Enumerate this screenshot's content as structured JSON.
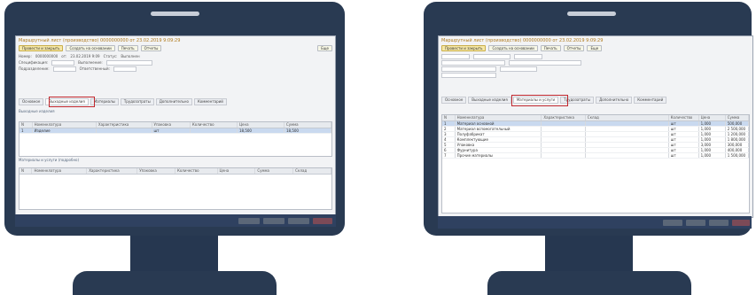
{
  "left_monitor": {
    "window_title": "Маршрутный лист (производство) 0000000000 от 23.02.2019 9:09:29",
    "toolbar": {
      "post_and_close": "Провести и закрыть",
      "create_based": "Создать на основании",
      "print": "Печать",
      "reports": "Отчеты",
      "more": "Еще"
    },
    "header_fields": {
      "number_label": "Номер:",
      "number_value": "0000000000",
      "date_label": "от:",
      "date_value": "23.02.2019 9:09",
      "status_label": "Статус:",
      "status_value": "Выполнен",
      "spec_label": "Спецификация:",
      "period_label": "Выполнение:",
      "dept_label": "Подразделение:",
      "resp_label": "Ответственный:"
    },
    "tabs": [
      "Основное",
      "Выходные изделия",
      "Материалы",
      "Трудозатраты",
      "Дополнительно",
      "Комментарий"
    ],
    "active_tab_index": 1,
    "top_section_label": "Выходные изделия",
    "top_grid": {
      "columns": [
        "N",
        "Номенклатура",
        "Характеристика",
        "Упаковка",
        "Количество",
        "Цена",
        "Сумма"
      ],
      "rows": [
        [
          "1",
          "Изделие",
          "",
          "шт",
          "",
          "18,500",
          "18,500"
        ]
      ]
    },
    "bottom_section_label": "Материалы и услуги (подробно)",
    "bottom_grid": {
      "columns": [
        "N",
        "Номенклатура",
        "Характеристика",
        "Упаковка",
        "Количество",
        "Цена",
        "Сумма",
        "Склад"
      ]
    }
  },
  "right_monitor": {
    "window_title": "Маршрутный лист (производство) 0000000000 от 23.02.2019 9:09:29",
    "toolbar": {
      "post_and_close": "Провести и закрыть",
      "create_based": "Создать на основании",
      "print": "Печать",
      "reports": "Отчеты",
      "more": "Еще"
    },
    "tabs": [
      "Основное",
      "Выходные изделия",
      "Материалы и услуги",
      "Трудозатраты",
      "Дополнительно",
      "Комментарий"
    ],
    "active_tab_index": 2,
    "grid": {
      "columns": [
        "N",
        "Номенклатура",
        "Характеристика",
        "Склад",
        "Количество",
        "Цена",
        "Сумма"
      ],
      "rows": [
        [
          "1",
          "Материал основной",
          "",
          "",
          "шт",
          "1,000",
          "500,000"
        ],
        [
          "2",
          "Материал вспомогательный",
          "",
          "",
          "шт",
          "1,000",
          "2 500,000"
        ],
        [
          "3",
          "Полуфабрикат",
          "",
          "",
          "шт",
          "1,000",
          "1 200,000"
        ],
        [
          "4",
          "Комплектующие",
          "",
          "",
          "шт",
          "1,000",
          "1 800,000"
        ],
        [
          "5",
          "Упаковка",
          "",
          "",
          "шт",
          "3,000",
          "300,000"
        ],
        [
          "6",
          "Фурнитура",
          "",
          "",
          "шт",
          "1,000",
          "400,000"
        ],
        [
          "7",
          "Прочие материалы",
          "",
          "",
          "шт",
          "1,000",
          "1 500,000"
        ]
      ]
    }
  }
}
